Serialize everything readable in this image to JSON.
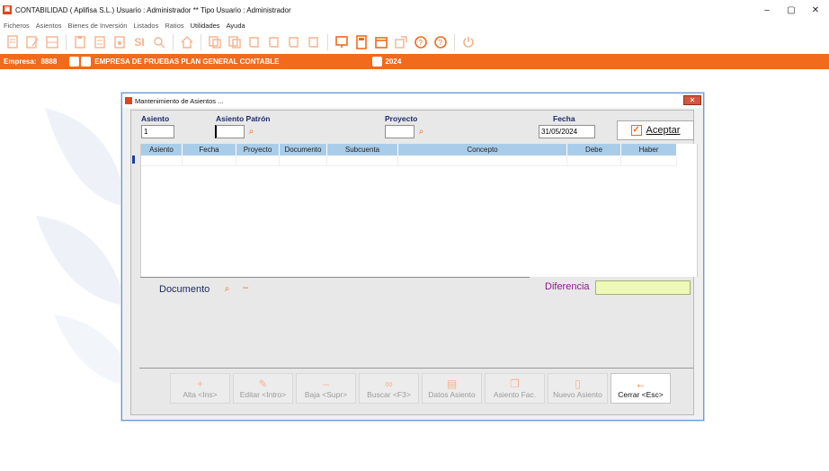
{
  "window": {
    "title": "CONTABILIDAD  ( Aplifisa S.L.)  Usuario : Administrador  **  Tipo Usuario : Administrador",
    "controls": [
      "–",
      "▢",
      "✕"
    ]
  },
  "menu": [
    "Ficheros",
    "Asientos",
    "Bienes de Inversión",
    "Listados",
    "Ratios",
    "Utilidades",
    "Ayuda"
  ],
  "empresa_bar": {
    "label": "Empresa:",
    "code": "8888",
    "name": "EMPRESA DE PRUEBAS PLAN GENERAL CONTABLE",
    "year": "2024"
  },
  "dialog": {
    "title": "Mantenimiento de Asientos ...",
    "asiento_label": "Asiento",
    "asiento_value": "1",
    "asiento_patron_label": "Asiento Patrón",
    "asiento_patron_value": "",
    "proyecto_label": "Proyecto",
    "proyecto_value": "",
    "fecha_label": "Fecha",
    "fecha_value": "31/05/2024",
    "aceptar_label": "Aceptar",
    "columns": [
      "Asiento",
      "Fecha",
      "Proyecto",
      "Documento",
      "Subcuenta",
      "Concepto",
      "Debe",
      "Haber"
    ],
    "documento_label": "Documento",
    "diferencia_label": "Diferencia",
    "diferencia_value": "",
    "buttons": [
      {
        "label": "Alta <Ins>",
        "icon": "plus-icon",
        "enabled": false
      },
      {
        "label": "Editar <Intro>",
        "icon": "edit-icon",
        "enabled": false
      },
      {
        "label": "Baja <Supr>",
        "icon": "minus-icon",
        "enabled": false
      },
      {
        "label": "Buscar <F3>",
        "icon": "binoculars-icon",
        "enabled": false
      },
      {
        "label": "Datos Asiento",
        "icon": "document-icon",
        "enabled": false
      },
      {
        "label": "Asiento Fac.",
        "icon": "copy-icon",
        "enabled": false
      },
      {
        "label": "Nuevo Asiento",
        "icon": "new-document-icon",
        "enabled": false
      },
      {
        "label": "Cerrar <Esc>",
        "icon": "arrow-left-icon",
        "enabled": true
      }
    ]
  },
  "colors": {
    "accent": "#f26a1b",
    "grid_header": "#a9cde9",
    "diferencia_field": "#eef9b8"
  }
}
